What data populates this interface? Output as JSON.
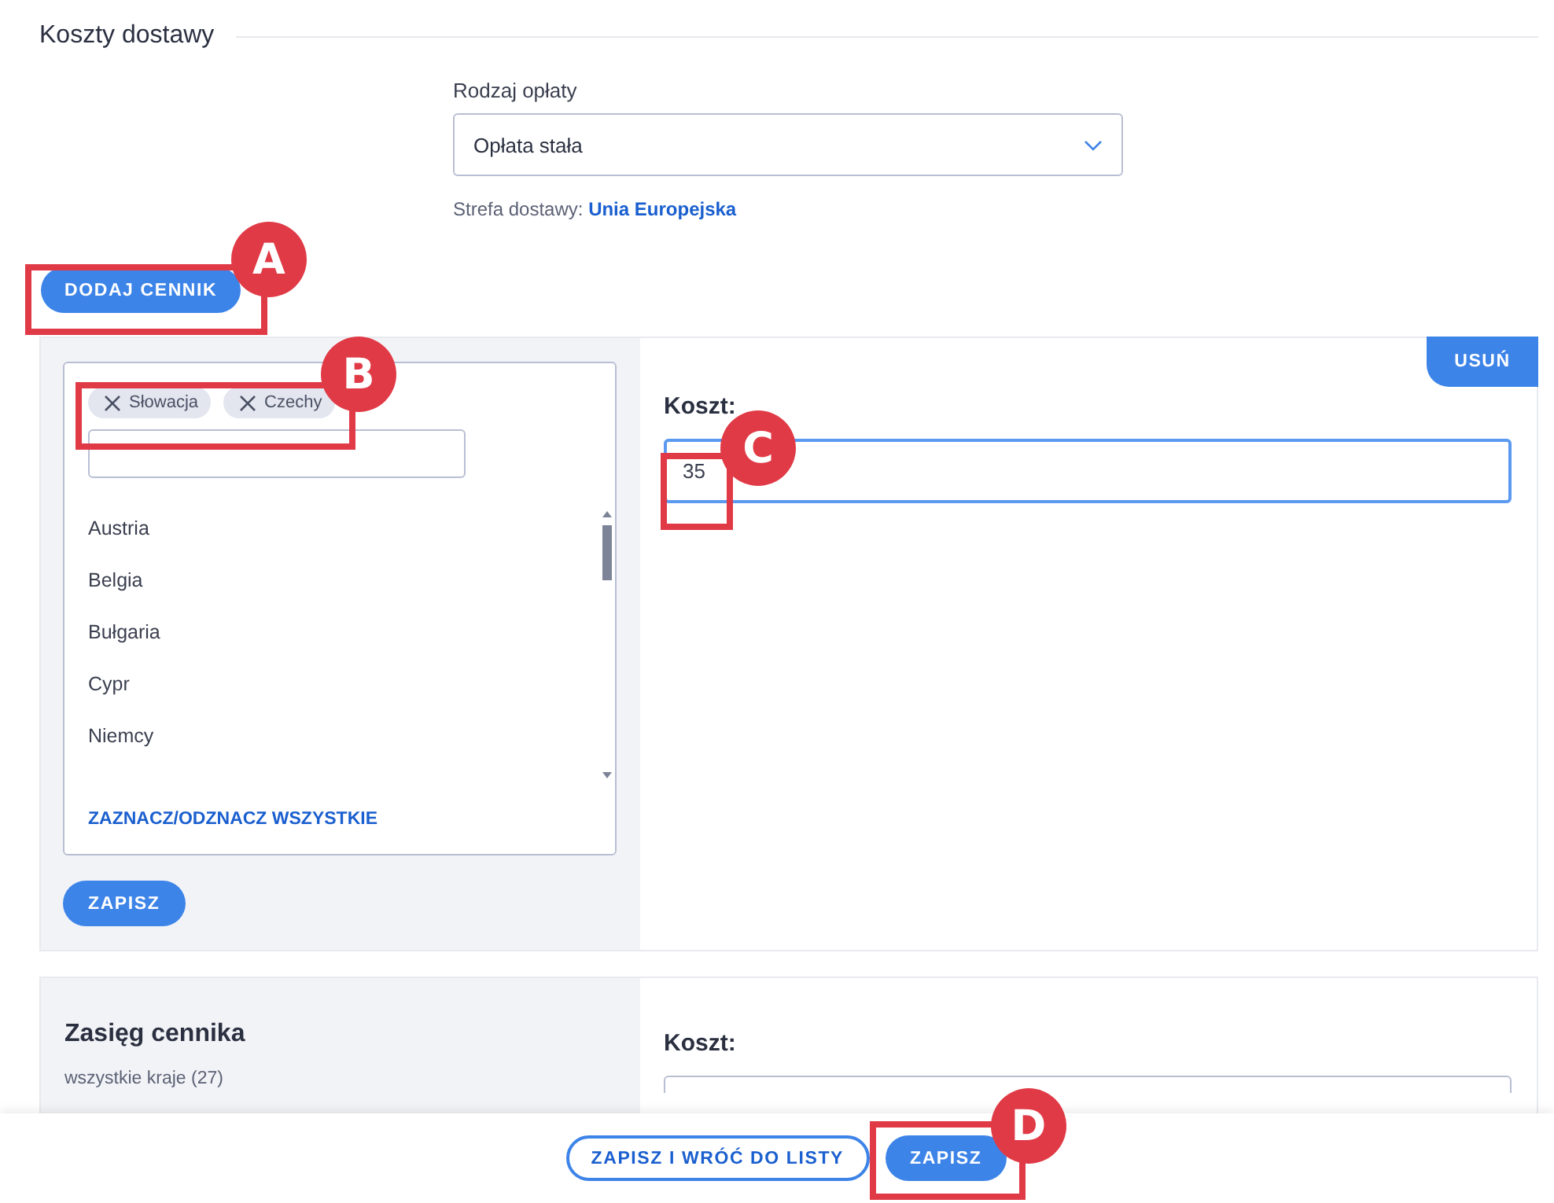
{
  "section": {
    "title": "Koszty dostawy"
  },
  "fee_type": {
    "label": "Rodzaj opłaty",
    "value": "Opłata stała"
  },
  "zone": {
    "label": "Strefa dostawy:",
    "value": "Unia Europejska"
  },
  "add_button": "DODAJ CENNIK",
  "price_lists": [
    {
      "chips": [
        "Słowacja",
        "Czechy"
      ],
      "countries": [
        "Austria",
        "Belgia",
        "Bułgaria",
        "Cypr",
        "Niemcy"
      ],
      "toggle_all": "ZAZNACZ/ODZNACZ WSZYSTKIE",
      "save": "ZAPISZ",
      "cost_label": "Koszt:",
      "cost_value": "35",
      "cost_focused": true,
      "remove": "USUŃ"
    },
    {
      "scope_title": "Zasięg cennika",
      "scope_text": "wszystkie kraje (27)",
      "cost_label": "Koszt:",
      "cost_focused": false
    }
  ],
  "footer": {
    "buttons": [
      {
        "label": "ZAPISZ I WRÓĆ DO LISTY",
        "kind": "outline"
      },
      {
        "label": "ZAPISZ",
        "kind": "primary"
      }
    ]
  },
  "callouts": [
    {
      "letter": "A"
    },
    {
      "letter": "B"
    },
    {
      "letter": "C"
    },
    {
      "letter": "D"
    }
  ]
}
